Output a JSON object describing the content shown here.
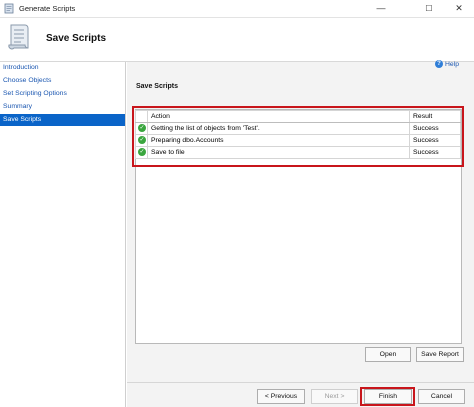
{
  "window": {
    "title": "Generate Scripts",
    "controls": {
      "minimize": "—",
      "maximize": "☐",
      "close": "✕"
    }
  },
  "header": {
    "title": "Save Scripts",
    "icon": "scroll-icon"
  },
  "sidebar": {
    "items": [
      {
        "label": "Introduction",
        "selected": false
      },
      {
        "label": "Choose Objects",
        "selected": false
      },
      {
        "label": "Set Scripting Options",
        "selected": false
      },
      {
        "label": "Summary",
        "selected": false
      },
      {
        "label": "Save Scripts",
        "selected": true
      }
    ]
  },
  "main": {
    "help_label": "Help",
    "section_title": "Save Scripts",
    "table": {
      "columns": [
        "Action",
        "Result"
      ],
      "rows": [
        {
          "action": "Getting the list of objects from 'Test'.",
          "result": "Success",
          "status_icon": "success-check-icon"
        },
        {
          "action": "Preparing dbo.Accounts",
          "result": "Success",
          "status_icon": "success-check-icon"
        },
        {
          "action": "Save to file",
          "result": "Success",
          "status_icon": "success-check-icon"
        }
      ]
    },
    "buttons": {
      "open": "Open",
      "save_report": "Save Report"
    }
  },
  "footer": {
    "previous": "< Previous",
    "next": "Next >",
    "finish": "Finish",
    "cancel": "Cancel"
  },
  "colors": {
    "accent": "#0a64c8",
    "highlight_frame": "#c8151b",
    "success": "#3aa63e"
  }
}
